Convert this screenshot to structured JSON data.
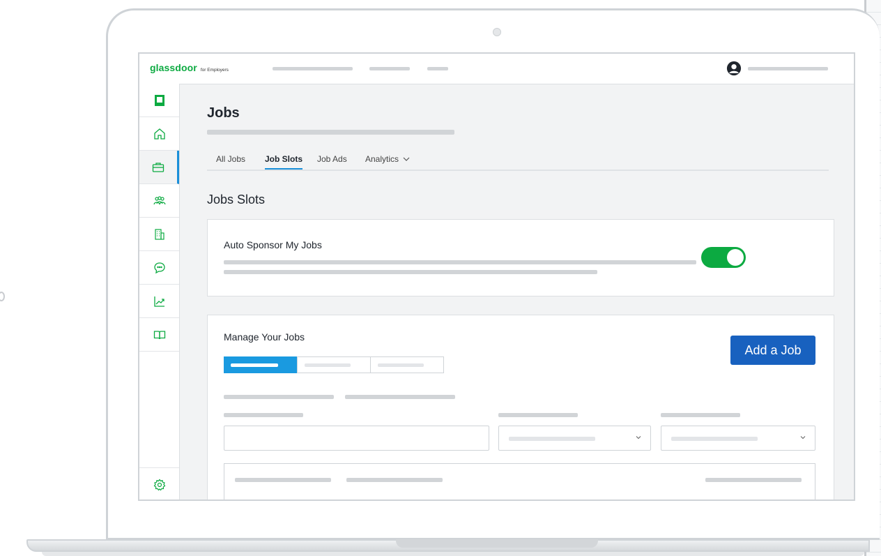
{
  "app": {
    "logo_main": "glassdoor",
    "logo_sub": "for Employers"
  },
  "page": {
    "title": "Jobs",
    "tabs": [
      {
        "label": "All Jobs",
        "active": false
      },
      {
        "label": "Job Slots",
        "active": true
      },
      {
        "label": "Job Ads",
        "active": false
      },
      {
        "label": "Analytics",
        "active": false,
        "has_dropdown": true
      }
    ],
    "section_title": "Jobs Slots"
  },
  "auto_sponsor": {
    "label": "Auto Sponsor My Jobs",
    "toggle_on": true
  },
  "manage_jobs": {
    "label": "Manage Your Jobs",
    "add_button": "Add a Job",
    "segments_active_index": 0
  },
  "sidebar": {
    "items": [
      "logo-icon",
      "home-icon",
      "briefcase-icon",
      "people-icon",
      "building-icon",
      "chat-icon",
      "analytics-icon",
      "book-icon"
    ],
    "active_index": 2,
    "bottom": "gear-icon"
  },
  "colors": {
    "brand_green": "#0caa41",
    "accent_blue": "#1a8fd9",
    "button_blue": "#1861bf"
  }
}
